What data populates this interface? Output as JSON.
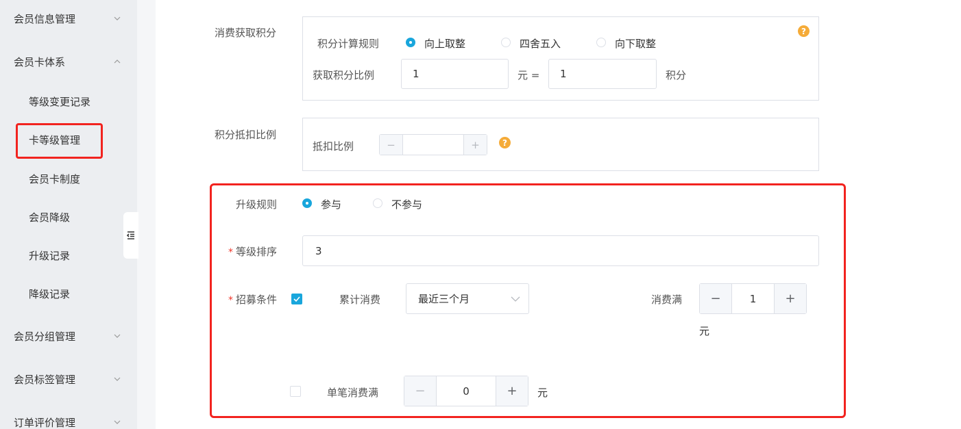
{
  "sidebar": {
    "items": [
      {
        "label": "会员信息管理",
        "expanded": false
      },
      {
        "label": "会员卡体系",
        "expanded": true
      },
      {
        "label": "等级变更记录"
      },
      {
        "label": "卡等级管理",
        "active": true
      },
      {
        "label": "会员卡制度"
      },
      {
        "label": "会员降级"
      },
      {
        "label": "升级记录"
      },
      {
        "label": "降级记录"
      },
      {
        "label": "会员分组管理",
        "expanded": false
      },
      {
        "label": "会员标签管理",
        "expanded": false
      },
      {
        "label": "订单评价管理",
        "expanded": false
      }
    ]
  },
  "points_earn": {
    "label": "消费获取积分",
    "rule_label": "积分计算规则",
    "rounding_options": [
      {
        "label": "向上取整",
        "selected": true
      },
      {
        "label": "四舍五入",
        "selected": false
      },
      {
        "label": "向下取整",
        "selected": false
      }
    ],
    "ratio_label": "获取积分比例",
    "yuan_value": "1",
    "yuan_unit": "元 =",
    "points_value": "1",
    "points_unit": "积分",
    "help_glyph": "?"
  },
  "points_deduct": {
    "label": "积分抵扣比例",
    "ratio_label": "抵扣比例",
    "value": "",
    "minus": "−",
    "plus": "+",
    "help_glyph": "?"
  },
  "upgrade_rule": {
    "label": "升级规则",
    "options": [
      {
        "label": "参与",
        "selected": true
      },
      {
        "label": "不参与",
        "selected": false
      }
    ]
  },
  "level_order": {
    "required": "*",
    "label": "等级排序",
    "value": "3"
  },
  "recruit": {
    "required": "*",
    "label": "招募条件",
    "cumulative": {
      "checked": true,
      "label": "累计消费",
      "period": "最近三个月",
      "threshold_label": "消费满",
      "value": "1",
      "unit": "元",
      "minus": "−",
      "plus": "+"
    },
    "single": {
      "checked": false,
      "label": "单笔消费满",
      "value": "0",
      "unit": "元",
      "minus": "−",
      "plus": "+"
    }
  },
  "colors": {
    "accent": "#19a6dc",
    "highlight": "#f2231f",
    "help": "#f5ab38",
    "sidebar_bg": "#eceef1"
  }
}
